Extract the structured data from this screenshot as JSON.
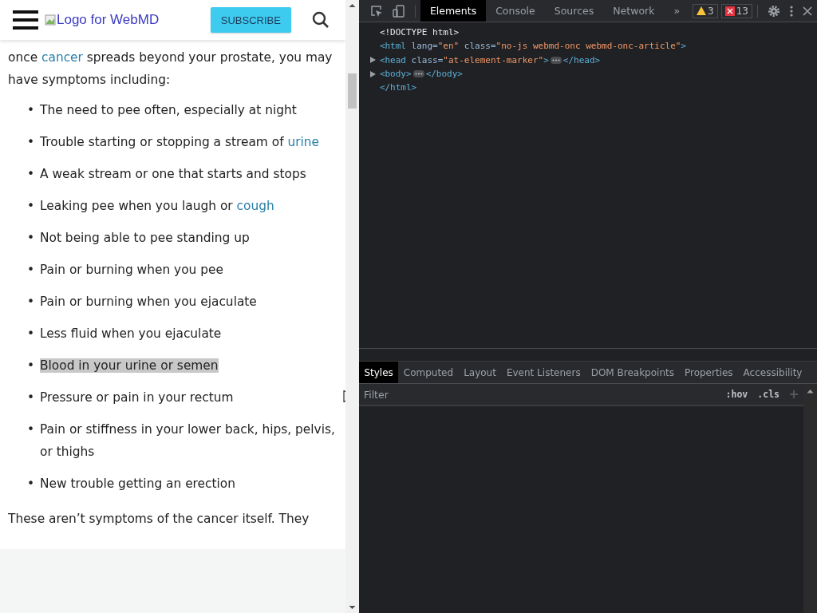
{
  "page": {
    "logo_alt": "Logo for WebMD",
    "subscribe": "SUBSCRIBE",
    "bullet": "•",
    "intro": [
      {
        "text": "once "
      },
      {
        "text": "cancer",
        "link": true
      },
      {
        "text": " spreads beyond your prostate, you may have symptoms including:"
      }
    ],
    "symptoms": [
      {
        "parts": [
          {
            "text": "The need to pee often, especially at night"
          }
        ],
        "highlighted": false
      },
      {
        "parts": [
          {
            "text": "Trouble starting or stopping a stream of "
          },
          {
            "text": "urine",
            "link": true
          }
        ],
        "highlighted": false
      },
      {
        "parts": [
          {
            "text": "A weak stream or one that starts and stops"
          }
        ],
        "highlighted": false
      },
      {
        "parts": [
          {
            "text": "Leaking pee when you laugh or "
          },
          {
            "text": "cough",
            "link": true
          }
        ],
        "highlighted": false
      },
      {
        "parts": [
          {
            "text": "Not being able to pee standing up"
          }
        ],
        "highlighted": false
      },
      {
        "parts": [
          {
            "text": "Pain or burning when you pee"
          }
        ],
        "highlighted": false
      },
      {
        "parts": [
          {
            "text": "Pain or burning when you ejaculate"
          }
        ],
        "highlighted": false
      },
      {
        "parts": [
          {
            "text": "Less fluid when you ejaculate"
          }
        ],
        "highlighted": false
      },
      {
        "parts": [
          {
            "text": "Blood in your urine or semen"
          }
        ],
        "highlighted": true
      },
      {
        "parts": [
          {
            "text": "Pressure or pain in your rectum"
          }
        ],
        "highlighted": false
      },
      {
        "parts": [
          {
            "text": "Pain or stiffness in your lower back, hips, pelvis, or thighs"
          }
        ],
        "highlighted": false
      },
      {
        "parts": [
          {
            "text": "New trouble getting an erection"
          }
        ],
        "highlighted": false
      }
    ],
    "outro": "These aren’t symptoms of the cancer itself. They"
  },
  "devtools": {
    "tabs": [
      {
        "label": "Elements",
        "selected": true
      },
      {
        "label": "Console",
        "selected": false
      },
      {
        "label": "Sources",
        "selected": false
      },
      {
        "label": "Network",
        "selected": false
      }
    ],
    "more": "»",
    "warnings": "3",
    "errors": "13",
    "dom_lines": [
      {
        "toggle": false,
        "segments": [
          {
            "kind": "code",
            "tokens": [
              {
                "t": "<!DOCTYPE html>",
                "kind": "plain"
              }
            ]
          }
        ]
      },
      {
        "toggle": false,
        "segments": [
          {
            "kind": "code",
            "tokens": [
              {
                "t": "<html",
                "kind": "tag"
              },
              {
                "t": " lang=",
                "kind": "attr"
              },
              {
                "t": "\"en\"",
                "kind": "value"
              },
              {
                "t": " class=",
                "kind": "attr"
              },
              {
                "t": "\"no-js webmd-onc webmd-onc-article\"",
                "kind": "value"
              },
              {
                "t": ">",
                "kind": "tag"
              }
            ]
          }
        ]
      },
      {
        "toggle": true,
        "segments": [
          {
            "kind": "code",
            "tokens": [
              {
                "t": "<head",
                "kind": "tag"
              },
              {
                "t": " class=",
                "kind": "attr"
              },
              {
                "t": "\"at-element-marker\"",
                "kind": "value"
              },
              {
                "t": ">",
                "kind": "tag"
              }
            ]
          },
          {
            "kind": "ellipsis"
          },
          {
            "kind": "code",
            "tokens": [
              {
                "t": "</head>",
                "kind": "tag"
              }
            ]
          }
        ]
      },
      {
        "toggle": true,
        "segments": [
          {
            "kind": "code",
            "tokens": [
              {
                "t": "<body>",
                "kind": "tag"
              }
            ]
          },
          {
            "kind": "ellipsis"
          },
          {
            "kind": "code",
            "tokens": [
              {
                "t": "</body>",
                "kind": "tag"
              }
            ]
          }
        ]
      },
      {
        "toggle": false,
        "segments": [
          {
            "kind": "code",
            "tokens": [
              {
                "t": "</html>",
                "kind": "tag"
              }
            ]
          }
        ]
      }
    ],
    "style_tabs": [
      {
        "label": "Styles",
        "selected": true
      },
      {
        "label": "Computed",
        "selected": false
      },
      {
        "label": "Layout",
        "selected": false
      },
      {
        "label": "Event Listeners",
        "selected": false
      },
      {
        "label": "DOM Breakpoints",
        "selected": false
      },
      {
        "label": "Properties",
        "selected": false
      },
      {
        "label": "Accessibility",
        "selected": false
      }
    ],
    "filter": {
      "placeholder": "Filter"
    },
    "hov": ":hov",
    "cls": ".cls"
  }
}
